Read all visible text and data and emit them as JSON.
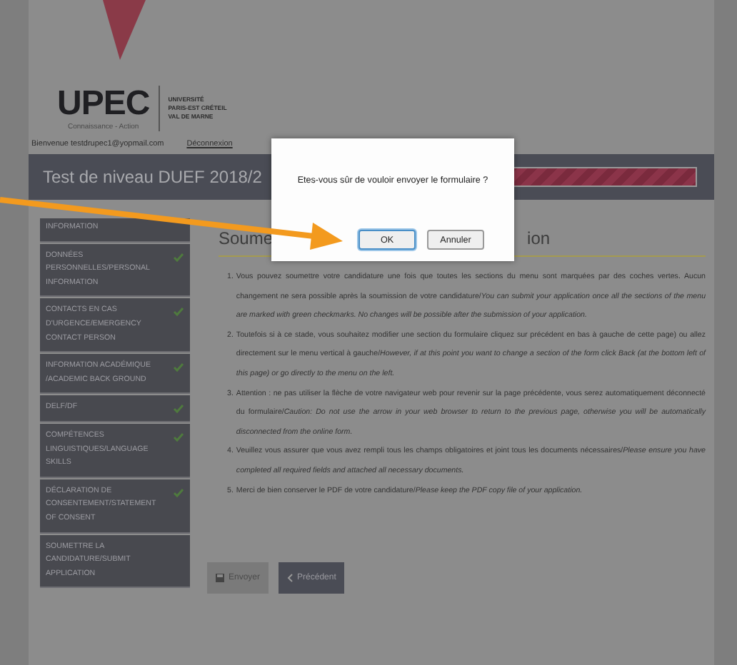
{
  "logo": {
    "wordmark": "UPEC",
    "tagline": "Connaissance - Action",
    "university": [
      "UNIVERSITÉ",
      "PARIS-EST CRÉTEIL",
      "VAL DE MARNE"
    ]
  },
  "user_bar": {
    "welcome": "Bienvenue testdrupec1@yopmail.com",
    "logout": "Déconnexion"
  },
  "title_bar": {
    "title": "Test de niveau DUEF 2018/2",
    "progress": {
      "level": 1
    }
  },
  "sidebar": {
    "items": [
      {
        "label": "INFORMATION",
        "checked": false
      },
      {
        "label": "DONNÉES PERSONNELLES/PERSONAL INFORMATION",
        "checked": true
      },
      {
        "label": "CONTACTS EN CAS D'URGENCE/EMERGENCY CONTACT PERSON",
        "checked": true
      },
      {
        "label": "INFORMATION ACADÉMIQUE /ACADEMIC BACK GROUND",
        "checked": true
      },
      {
        "label": "DELF/DF",
        "checked": true
      },
      {
        "label": "COMPÉTENCES LINGUISTIQUES/LANGUAGE SKILLS",
        "checked": true
      },
      {
        "label": "DÉCLARATION DE CONSENTEMENT/STATEMENT OF CONSENT",
        "checked": true
      },
      {
        "label": "SOUMETTRE LA CANDIDATURE/SUBMIT APPLICATION",
        "checked": false
      }
    ]
  },
  "main": {
    "heading_parts": [
      "Soume",
      "ion"
    ],
    "instructions": [
      {
        "number": "1.",
        "text": "Vous pouvez soumettre votre candidature une fois que toutes les sections du menu sont marquées par des coches vertes. Aucun changement ne sera possible après la soumission de votre candidature/*You can submit your application once all the sections of the menu are marked with green checkmarks. No changes will be possible after the submission of your application.*"
      },
      {
        "number": "2.",
        "text": "Toutefois si à ce stade, vous souhaitez modifier une section du formulaire cliquez sur précédent en bas à gauche de cette page) ou allez directement sur le menu vertical à gauche/*However, if at this point you want to change a section of the form click Back (at the bottom left of this page) or go directly to the menu on the left.*"
      },
      {
        "number": "3.",
        "text": "Attention : ne pas utiliser la flèche de votre navigateur web pour revenir sur la page précédente, vous serez automatiquement déconnecté du formulaire/*Caution: Do not use the arrow in your web browser to return to the previous page, otherwise you will be automatically disconnected from the online form.*"
      },
      {
        "number": "4.",
        "text": "Veuillez vous assurer que vous avez rempli tous les champs obligatoires et joint tous les documents nécessaires/*Please ensure you have completed all required fields and attached all necessary documents.*"
      },
      {
        "number": "5.",
        "text": "Merci de bien conserver le PDF de votre candidature/*Please keep the PDF copy file of your application.*"
      }
    ],
    "buttons": [
      {
        "label": "Envoyer",
        "kind": "submit"
      },
      {
        "label": "Précédent",
        "kind": "back"
      }
    ]
  },
  "dialog": {
    "message": "Etes-vous sûr de vouloir envoyer le formulaire ?",
    "buttons": [
      {
        "label": "OK",
        "selected": true
      },
      {
        "label": "Annuler",
        "selected": false
      }
    ]
  }
}
